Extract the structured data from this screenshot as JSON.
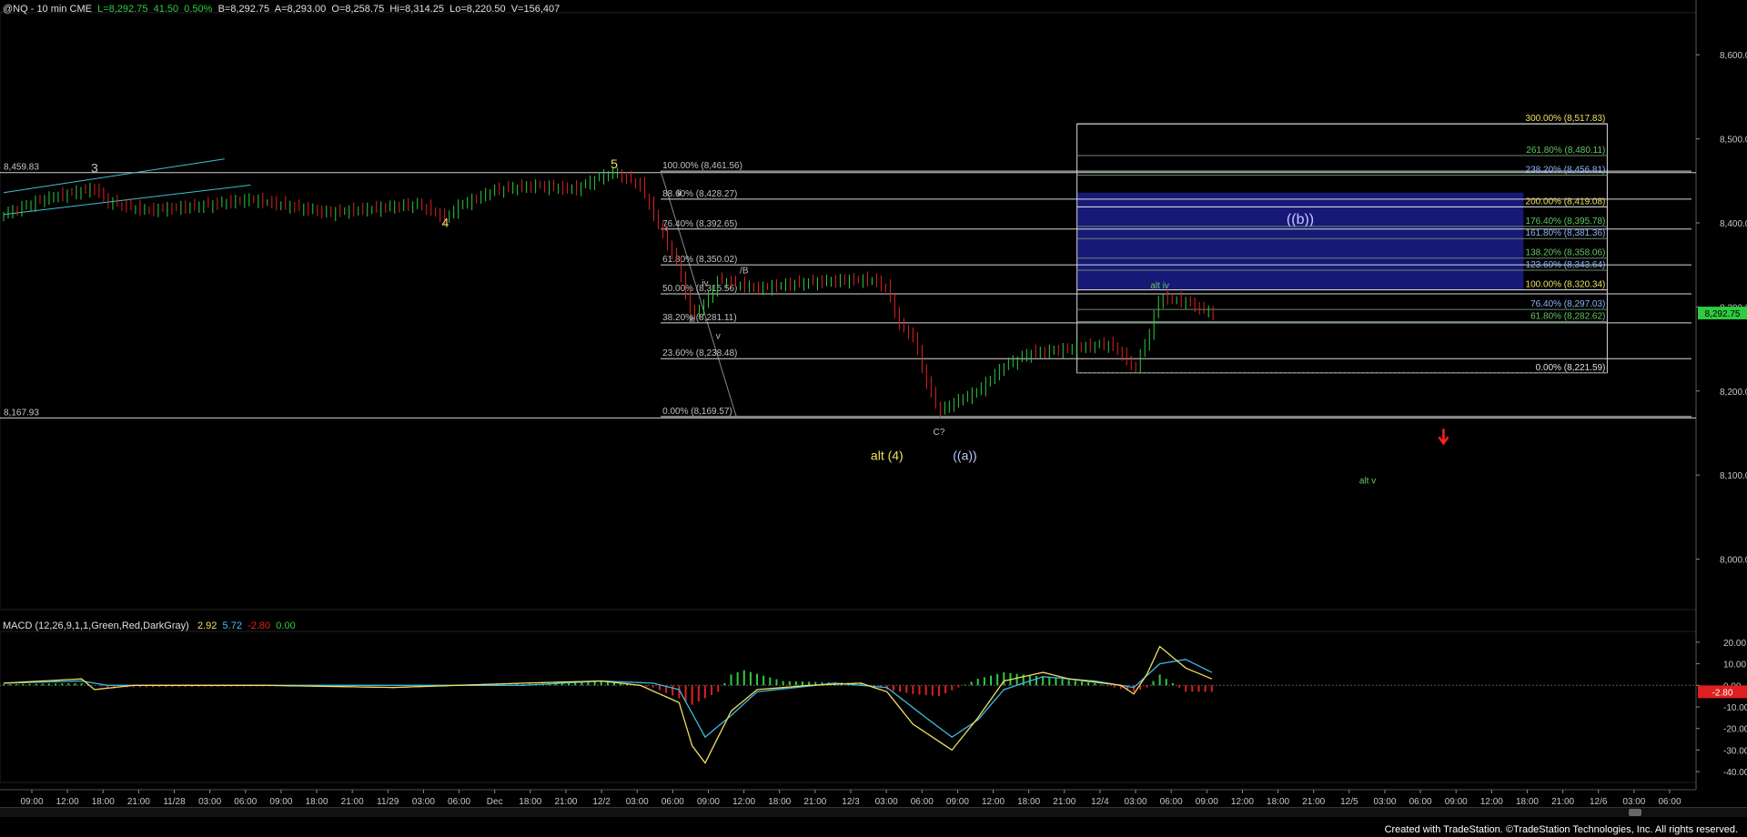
{
  "header": {
    "symbol": "@NQ - 10 min CME",
    "last": "L=8,292.75",
    "change": "41.50",
    "change_pct": "0.50%",
    "bid": "B=8,292.75",
    "ask": "A=8,293.00",
    "open": "O=8,258.75",
    "high": "Hi=8,314.25",
    "low": "Lo=8,220.50",
    "volume": "V=156,407"
  },
  "macd_header": {
    "label": "MACD (12,26,9,1,1,Green,Red,DarkGray)",
    "v1": "2.92",
    "v2": "5.72",
    "v3": "-2.80",
    "v4": "0.00"
  },
  "footer": "Created with TradeStation. ©TradeStation Technologies, Inc. All rights reserved.",
  "colors": {
    "background": "#000000",
    "up_bar": "#2ecc40",
    "down_bar": "#e02020",
    "yellow_label": "#f0e060",
    "fib_text": "#c0c0c0",
    "fib_ext_blue": "#8ab4ff",
    "fib_ext_green": "#60c860",
    "box_fill": "#1c1c8c",
    "trendline": "#40c0d0"
  },
  "chart_data": {
    "type": "candlestick",
    "price_axis": {
      "min": 7940,
      "max": 8650,
      "ticks": [
        "8,600.00",
        "8,500.00",
        "8,400.00",
        "8,300.00",
        "8,200.00",
        "8,100.00",
        "8,000.00"
      ]
    },
    "last_price_tag": "8,292.75",
    "x_ticks": [
      "09:00",
      "12:00",
      "18:00",
      "21:00",
      "11/28",
      "03:00",
      "06:00",
      "09:00",
      "18:00",
      "21:00",
      "11/29",
      "03:00",
      "06:00",
      "Dec",
      "18:00",
      "21:00",
      "12/2",
      "03:00",
      "06:00",
      "09:00",
      "12:00",
      "18:00",
      "21:00",
      "12/3",
      "03:00",
      "06:00",
      "09:00",
      "12:00",
      "18:00",
      "21:00",
      "12/4",
      "03:00",
      "06:00",
      "09:00",
      "12:00",
      "18:00",
      "21:00",
      "12/5",
      "03:00",
      "06:00",
      "09:00",
      "12:00",
      "18:00",
      "21:00",
      "12/6",
      "03:00",
      "06:00"
    ],
    "price_path": [
      [
        0,
        8410
      ],
      [
        3,
        8428
      ],
      [
        6,
        8438
      ],
      [
        7,
        8441
      ],
      [
        8,
        8425
      ],
      [
        11,
        8415
      ],
      [
        15,
        8420
      ],
      [
        19,
        8428
      ],
      [
        22,
        8420
      ],
      [
        25,
        8412
      ],
      [
        29,
        8418
      ],
      [
        32,
        8422
      ],
      [
        34,
        8405
      ],
      [
        35,
        8420
      ],
      [
        38,
        8440
      ],
      [
        41,
        8444
      ],
      [
        44,
        8440
      ],
      [
        46,
        8455
      ],
      [
        47,
        8460
      ],
      [
        49,
        8445
      ],
      [
        52,
        8345
      ],
      [
        53,
        8288
      ],
      [
        54,
        8305
      ],
      [
        55,
        8332
      ],
      [
        58,
        8322
      ],
      [
        61,
        8328
      ],
      [
        65,
        8332
      ],
      [
        67,
        8332
      ],
      [
        68,
        8322
      ],
      [
        69,
        8277
      ],
      [
        70,
        8265
      ],
      [
        71,
        8212
      ],
      [
        72,
        8175
      ],
      [
        73,
        8185
      ],
      [
        75,
        8200
      ],
      [
        77,
        8230
      ],
      [
        79,
        8245
      ],
      [
        81,
        8248
      ],
      [
        83,
        8252
      ],
      [
        85,
        8256
      ],
      [
        86,
        8246
      ],
      [
        87,
        8225
      ],
      [
        88,
        8260
      ],
      [
        89,
        8312
      ],
      [
        91,
        8306
      ],
      [
        93,
        8292
      ]
    ],
    "fib_retracement": [
      {
        "label": "100.00% (8,461.56)",
        "value": 8461.56
      },
      {
        "label": "88.60% (8,428.27)",
        "value": 8428.27
      },
      {
        "label": "76.40% (8,392.65)",
        "value": 8392.65
      },
      {
        "label": "61.80% (8,350.02)",
        "value": 8350.02
      },
      {
        "label": "50.00% (8,315.56)",
        "value": 8315.56
      },
      {
        "label": "38.20% (8,281.11)",
        "value": 8281.11
      },
      {
        "label": "23.60% (8,238.48)",
        "value": 8238.48
      },
      {
        "label": "0.00% (8,169.57)",
        "value": 8169.57
      }
    ],
    "fib_extension": [
      {
        "label": "300.00% (8,517.83)",
        "value": 8517.83,
        "color": "yellow"
      },
      {
        "label": "261.80% (8,480.11)",
        "value": 8480.11,
        "color": "green"
      },
      {
        "label": "238.20% (8,456.81)",
        "value": 8456.81,
        "color": "blue"
      },
      {
        "label": "200.00% (8,419.08)",
        "value": 8419.08,
        "color": "yellow"
      },
      {
        "label": "176.40% (8,395.78)",
        "value": 8395.78,
        "color": "green"
      },
      {
        "label": "161.80% (8,381.36)",
        "value": 8381.36,
        "color": "blue"
      },
      {
        "label": "138.20% (8,358.06)",
        "value": 8358.06,
        "color": "green"
      },
      {
        "label": "123.60% (8,343.64)",
        "value": 8343.64,
        "color": "blue"
      },
      {
        "label": "100.00% (8,320.34)",
        "value": 8320.34,
        "color": "yellow"
      },
      {
        "label": "76.40% (8,297.03)",
        "value": 8297.03,
        "color": "blue"
      },
      {
        "label": "61.80% (8,282.62)",
        "value": 8282.62,
        "color": "green"
      },
      {
        "label": "0.00% (8,221.59)",
        "value": 8221.59,
        "color": "white"
      }
    ],
    "horizontal_levels": [
      {
        "label": "8,459.83",
        "value": 8459.83
      },
      {
        "label": "8,167.93",
        "value": 8167.93
      }
    ],
    "target_box": {
      "label": "((b))",
      "from": 8320.34,
      "to": 8436
    },
    "wave_labels": [
      {
        "text": "3",
        "bar": 7,
        "price": 8460,
        "color": "gray"
      },
      {
        "text": "4",
        "bar": 34,
        "price": 8395,
        "color": "yellow"
      },
      {
        "text": "5",
        "bar": 47,
        "price": 8465,
        "color": "yellow"
      },
      {
        "text": "i",
        "bar": 51,
        "price": 8390,
        "color": "gray"
      },
      {
        "text": "ii",
        "bar": 52,
        "price": 8432,
        "color": "gray"
      },
      {
        "text": "iii",
        "bar": 53,
        "price": 8282,
        "color": "gray"
      },
      {
        "text": "iv",
        "bar": 54,
        "price": 8325,
        "color": "gray"
      },
      {
        "text": "v",
        "bar": 55,
        "price": 8262,
        "color": "gray"
      },
      {
        "text": "/B",
        "bar": 57,
        "price": 8340,
        "color": "gray"
      },
      {
        "text": "C?",
        "bar": 72,
        "price": 8148,
        "color": "gray"
      },
      {
        "text": "alt (4)",
        "bar": 68,
        "price": 8118,
        "color": "yellow"
      },
      {
        "text": "((a))",
        "bar": 74,
        "price": 8118,
        "color": "blue"
      },
      {
        "text": "alt iv",
        "bar": 89,
        "price": 8322,
        "color": "green"
      },
      {
        "text": "alt v",
        "bar": 105,
        "price": 8090,
        "color": "green"
      }
    ],
    "macd": {
      "axis": {
        "min": -45,
        "max": 25,
        "ticks": [
          "20.00",
          "10.00",
          "0.00",
          "-10.00",
          "-20.00",
          "-30.00",
          "-40.00"
        ]
      },
      "macd_line": [
        [
          0,
          1
        ],
        [
          6,
          3
        ],
        [
          7,
          -2
        ],
        [
          10,
          0
        ],
        [
          20,
          0
        ],
        [
          30,
          -1
        ],
        [
          40,
          1
        ],
        [
          46,
          2
        ],
        [
          49,
          0
        ],
        [
          52,
          -8
        ],
        [
          53,
          -28
        ],
        [
          54,
          -36
        ],
        [
          56,
          -12
        ],
        [
          58,
          -2
        ],
        [
          62,
          0
        ],
        [
          66,
          1
        ],
        [
          68,
          -3
        ],
        [
          70,
          -18
        ],
        [
          71,
          -22
        ],
        [
          73,
          -30
        ],
        [
          75,
          -15
        ],
        [
          77,
          2
        ],
        [
          80,
          6
        ],
        [
          82,
          3
        ],
        [
          86,
          0
        ],
        [
          87,
          -4
        ],
        [
          88,
          5
        ],
        [
          89,
          18
        ],
        [
          91,
          8
        ],
        [
          93,
          3
        ]
      ],
      "signal_line": [
        [
          0,
          1
        ],
        [
          6,
          2
        ],
        [
          8,
          0
        ],
        [
          20,
          0
        ],
        [
          40,
          0
        ],
        [
          46,
          2
        ],
        [
          50,
          1
        ],
        [
          52,
          -2
        ],
        [
          54,
          -24
        ],
        [
          56,
          -14
        ],
        [
          58,
          -3
        ],
        [
          64,
          1
        ],
        [
          68,
          -1
        ],
        [
          71,
          -15
        ],
        [
          73,
          -24
        ],
        [
          75,
          -16
        ],
        [
          77,
          -2
        ],
        [
          80,
          4
        ],
        [
          84,
          2
        ],
        [
          87,
          -1
        ],
        [
          89,
          10
        ],
        [
          91,
          12
        ],
        [
          93,
          6
        ]
      ],
      "histogram": [
        [
          0,
          0.5
        ],
        [
          6,
          1
        ],
        [
          8,
          -1
        ],
        [
          20,
          -0.5
        ],
        [
          40,
          0.5
        ],
        [
          46,
          2
        ],
        [
          50,
          -1
        ],
        [
          52,
          -6
        ],
        [
          53,
          -9
        ],
        [
          55,
          -3
        ],
        [
          56,
          5
        ],
        [
          57,
          7
        ],
        [
          60,
          2
        ],
        [
          66,
          1
        ],
        [
          68,
          -2
        ],
        [
          70,
          -4
        ],
        [
          72,
          -5
        ],
        [
          75,
          3
        ],
        [
          77,
          6
        ],
        [
          80,
          4
        ],
        [
          84,
          1
        ],
        [
          87,
          -3
        ],
        [
          88,
          -1
        ],
        [
          89,
          5
        ],
        [
          91,
          -3
        ],
        [
          93,
          -3
        ]
      ]
    }
  }
}
